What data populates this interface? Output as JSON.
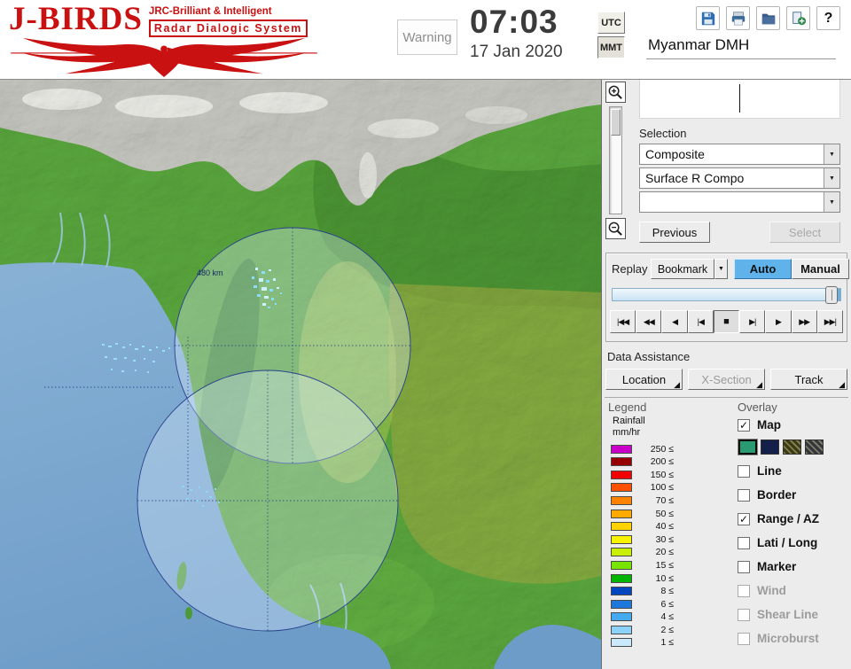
{
  "header": {
    "logo": {
      "title": "J-BIRDS",
      "subtitle1": "JRC-Brilliant & Intelligent",
      "subtitle2": "Radar  Dialogic  System"
    },
    "warning_label": "Warning",
    "clock": {
      "time": "07:03",
      "date": "17 Jan 2020"
    },
    "timezone": {
      "utc_label": "UTC",
      "mmt_label": "MMT",
      "selected": "MMT"
    },
    "toolbar": {
      "help_glyph": "?"
    },
    "station_title": "Myanmar DMH"
  },
  "map": {
    "range_label": "480 km"
  },
  "icons": {
    "dropdown_arrow": "▼",
    "corner_triangle": "◢"
  },
  "panel": {
    "selection": {
      "label": "Selection",
      "dropdown1": "Composite",
      "dropdown2": "Surface R Compo",
      "dropdown3": "",
      "previous_label": "Previous",
      "select_label": "Select"
    },
    "replay": {
      "label": "Replay",
      "bookmark_label": "Bookmark",
      "auto_label": "Auto",
      "manual_label": "Manual",
      "playback": [
        "|◀◀",
        "◀◀",
        "◀",
        "|◀",
        "■",
        "▶|",
        "▶",
        "▶▶",
        "▶▶|"
      ]
    },
    "data_assistance": {
      "label": "Data Assistance",
      "location_label": "Location",
      "xsection_label": "X-Section",
      "track_label": "Track"
    },
    "legend": {
      "label": "Legend",
      "unit1": "Rainfall",
      "unit2": "mm/hr",
      "entries": [
        {
          "value": "250 ≤",
          "color": "#c800c8"
        },
        {
          "value": "200 ≤",
          "color": "#960000"
        },
        {
          "value": "150 ≤",
          "color": "#f00000"
        },
        {
          "value": "100 ≤",
          "color": "#ff5000"
        },
        {
          "value": "70 ≤",
          "color": "#ff8200"
        },
        {
          "value": "50 ≤",
          "color": "#ffaa00"
        },
        {
          "value": "40 ≤",
          "color": "#ffd200"
        },
        {
          "value": "30 ≤",
          "color": "#f8f400"
        },
        {
          "value": "20 ≤",
          "color": "#c8f000"
        },
        {
          "value": "15 ≤",
          "color": "#78e400"
        },
        {
          "value": "10 ≤",
          "color": "#00b400"
        },
        {
          "value": "8 ≤",
          "color": "#0046be"
        },
        {
          "value": "6 ≤",
          "color": "#1e78dc"
        },
        {
          "value": "4 ≤",
          "color": "#46aaf0"
        },
        {
          "value": "2 ≤",
          "color": "#8cd2fa"
        },
        {
          "value": "1 ≤",
          "color": "#c8eafc"
        }
      ]
    },
    "overlay": {
      "label": "Overlay",
      "items": [
        {
          "label": "Map",
          "check": "✓",
          "disabled": false
        },
        {
          "label": "Line",
          "check": "",
          "disabled": false
        },
        {
          "label": "Border",
          "check": "",
          "disabled": false
        },
        {
          "label": "Range / AZ",
          "check": "✓",
          "disabled": false
        },
        {
          "label": "Lati / Long",
          "check": "",
          "disabled": false
        },
        {
          "label": "Marker",
          "check": "",
          "disabled": false
        },
        {
          "label": "Wind",
          "check": "",
          "disabled": true
        },
        {
          "label": "Shear Line",
          "check": "",
          "disabled": true
        },
        {
          "label": "Microburst",
          "check": "",
          "disabled": true
        }
      ],
      "styles": [
        "#2a9a72",
        "#14204a",
        "#3c3a12",
        "#34343a"
      ]
    }
  }
}
